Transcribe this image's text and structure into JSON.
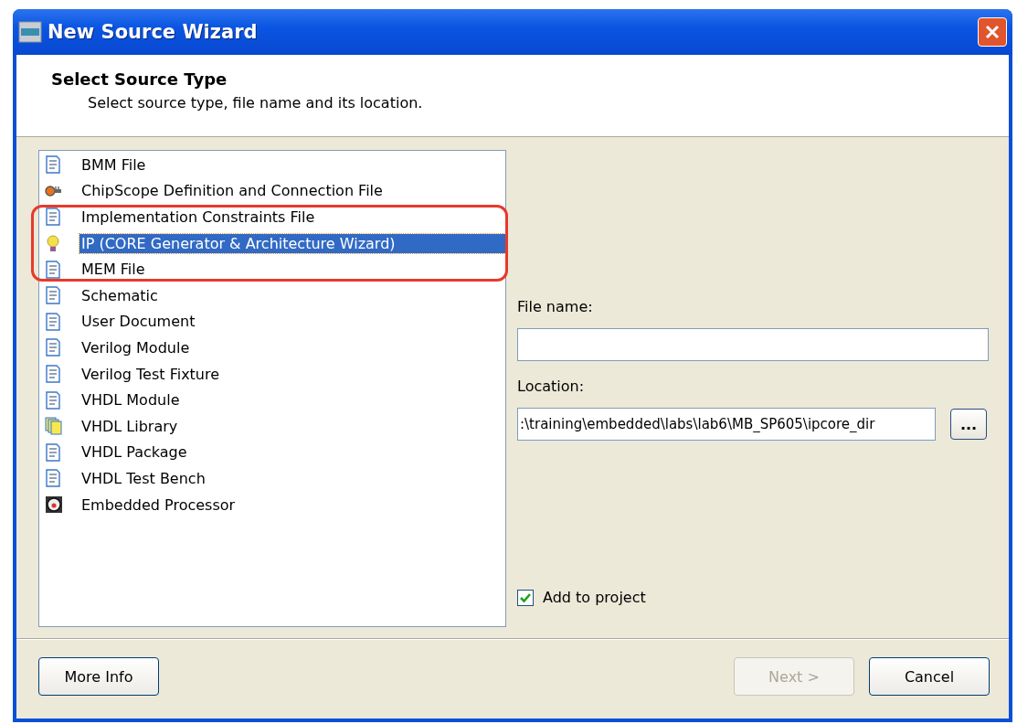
{
  "window": {
    "title": "New Source Wizard"
  },
  "header": {
    "title": "Select Source Type",
    "subtitle": "Select source type, file name and its location."
  },
  "source_types": [
    {
      "label": "BMM File",
      "selected": false,
      "circled": false
    },
    {
      "label": "ChipScope Definition and Connection File",
      "selected": false,
      "circled": false
    },
    {
      "label": "Implementation Constraints File",
      "selected": false,
      "circled": true
    },
    {
      "label": "IP (CORE Generator & Architecture Wizard)",
      "selected": true,
      "circled": true
    },
    {
      "label": "MEM File",
      "selected": false,
      "circled": true
    },
    {
      "label": "Schematic",
      "selected": false,
      "circled": false
    },
    {
      "label": "User Document",
      "selected": false,
      "circled": false
    },
    {
      "label": "Verilog Module",
      "selected": false,
      "circled": false
    },
    {
      "label": "Verilog Test Fixture",
      "selected": false,
      "circled": false
    },
    {
      "label": "VHDL Module",
      "selected": false,
      "circled": false
    },
    {
      "label": "VHDL Library",
      "selected": false,
      "circled": false
    },
    {
      "label": "VHDL Package",
      "selected": false,
      "circled": false
    },
    {
      "label": "VHDL Test Bench",
      "selected": false,
      "circled": false
    },
    {
      "label": "Embedded Processor",
      "selected": false,
      "circled": false
    }
  ],
  "file_name": {
    "label": "File name:"
  },
  "location": {
    "label": "Location:",
    "value": ":\\training\\embedded\\labs\\lab6\\MB_SP605\\ipcore_dir",
    "browse": "..."
  },
  "add_to_project": {
    "label": "Add to project",
    "checked": true
  },
  "buttons": [
    {
      "label": "More Info",
      "disabled": false
    },
    {
      "label": "Next >",
      "disabled": true
    },
    {
      "label": "Cancel",
      "disabled": false
    }
  ]
}
